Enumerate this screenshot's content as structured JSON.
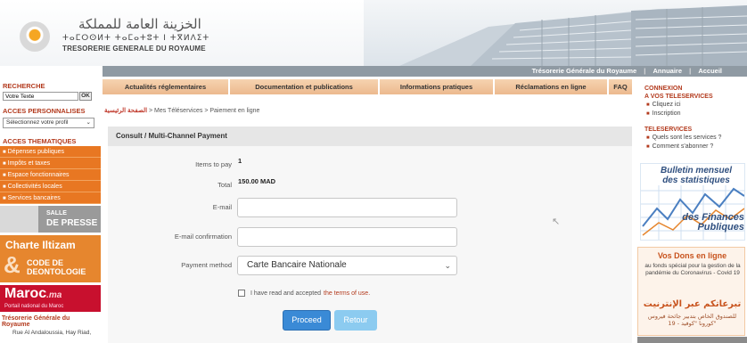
{
  "header": {
    "logo_arabic": "الخزينة العامة للمملكة",
    "logo_tifinagh": "ⵜⴰⵎⵔⵙⵍⵜ ⵜⴰⵎⴰⵜⵓⵜ ⵏ ⵜⴳⵍⴷⵉⵜ",
    "logo_french": "TRESORERIE GENERALE DU ROYAUME"
  },
  "topbar": {
    "links": [
      "Trésorerie Générale du Royaume",
      "Annuaire",
      "Accueil"
    ],
    "separator": "|"
  },
  "left": {
    "search_title": "RECHERCHE",
    "search_value": "Votre Texte",
    "ok_label": "OK",
    "perso_title": "ACCES PERSONNALISES",
    "profile_select": "Sélectionnez votre profil",
    "themes_title": "ACCES THEMATIQUES",
    "themes": [
      "Dépenses publiques",
      "Impôts et taxes",
      "Espace fonctionnaires",
      "Collectivités locales",
      "Services bancaires"
    ],
    "bullet": "■",
    "presse_small": "SALLE",
    "presse_big": "DE PRESSE",
    "charte_title": "Charte Iltizam",
    "charte_amp": "&",
    "charte_sub1": "CODE DE",
    "charte_sub2": "DEONTOLOGIE",
    "maroc_name": "Maroc",
    "maroc_tld": ".ma",
    "maroc_sub": "Portail national du Maroc",
    "tgr_label": "Trésorerie Générale du Royaume",
    "address": "Rue Al Andaloussia, Hay Riad,"
  },
  "nav": {
    "items": [
      "Actualités réglementaires",
      "Documentation et publications",
      "Informations pratiques",
      "Réclamations en ligne",
      "FAQ"
    ]
  },
  "breadcrumb": {
    "home": "الصفحة الرئيسية",
    "sep": ">",
    "path": [
      "Mes Téléservices",
      "Paiement en ligne"
    ]
  },
  "form": {
    "title": "Consult / Multi-Channel Payment",
    "items_label": "Items to pay",
    "items_value": "1",
    "total_label": "Total",
    "total_value": "150.00 MAD",
    "email_label": "E-mail",
    "email_value": "",
    "email_confirm_label": "E-mail confirmation",
    "email_confirm_value": "",
    "payment_label": "Payment method",
    "payment_value": "Carte Bancaire Nationale",
    "terms_text": "I have read and accepted",
    "terms_link": "the terms of use.",
    "proceed_label": "Proceed",
    "retour_label": "Retour"
  },
  "right": {
    "connexion_title_1": "CONNEXION",
    "connexion_title_2": "A VOS TELESERVICES",
    "connexion_links": [
      "Cliquez ici",
      "Inscription"
    ],
    "teleservices_title": "TELESERVICES",
    "teleservices_links": [
      "Quels sont les services ?",
      "Comment s'abonner ?"
    ],
    "bulletin_title": "Bulletin mensuel des statistiques",
    "bulletin_finances": "des Finances Publiques",
    "dons_title": "Vos Dons en ligne",
    "dons_sub": "au fonds spécial pour la gestion de la pandémie du Coronavirus - Covid 19",
    "dons_ar1": "تبرعاتكم عبر الإنترنيت",
    "dons_ar2": "للصندوق الخاص بتدبير جائحة فيروس كورونا \"كوفيد - 19\""
  },
  "colors": {
    "accent_orange": "#e87722",
    "brand_red": "#b33a1d",
    "topbar_gray": "#8f9aa3",
    "proceed_blue": "#3a8ad6",
    "retour_blue": "#8ccbf0"
  }
}
